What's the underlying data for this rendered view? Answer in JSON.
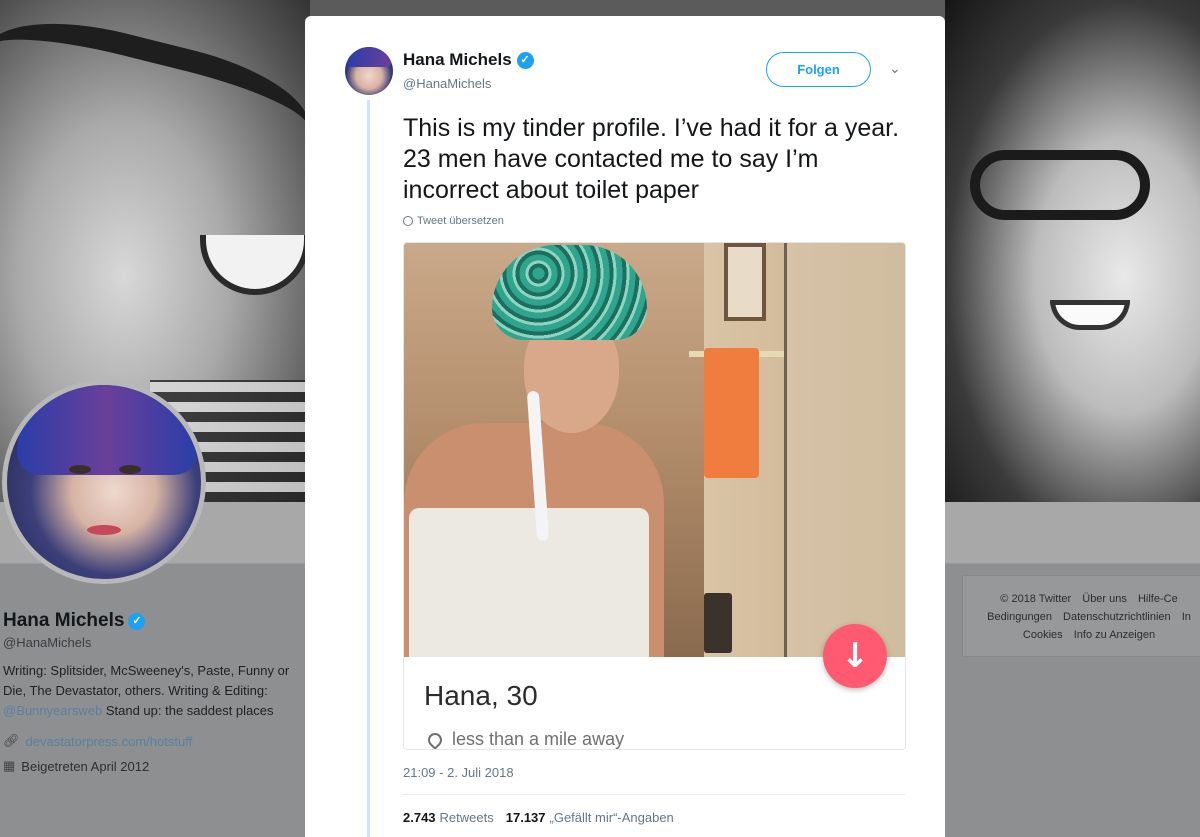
{
  "profile": {
    "name": "Hana Michels",
    "handle": "@HanaMichels",
    "bio_text": "Writing: Splitsider, McSweeney's, Paste, Funny or Die, The Devastator, others. Writing & Editing:",
    "bio_link": "@Bunnyearsweb",
    "bio_tail": "Stand up: the saddest places",
    "website": "devastatorpress.com/hotstuff",
    "joined": "Beigetreten April 2012"
  },
  "footer": {
    "links": [
      "© 2018 Twitter",
      "Über uns",
      "Hilfe-Ce",
      "Bedingungen",
      "Datenschutzrichtlinien",
      "In",
      "Cookies",
      "Info zu Anzeigen"
    ]
  },
  "tweet": {
    "author_name": "Hana Michels",
    "author_handle": "@HanaMichels",
    "follow_label": "Folgen",
    "text": "This is my tinder profile. I’ve had it for a year. 23 men have contacted me to say I’m incorrect about toilet paper",
    "translate_label": "Tweet übersetzen",
    "timestamp": "21:09 - 2. Juli 2018",
    "retweets_count": "2.743",
    "retweets_label": "Retweets",
    "likes_count": "17.137",
    "likes_label": "„Gefällt mir“-Angaben"
  },
  "card": {
    "name_age": "Hana, 30",
    "distance": "less than a mile away",
    "button_icon": "arrow-down-icon",
    "button_color": "#ff5a71"
  },
  "colors": {
    "twitter_blue": "#1da1f2",
    "muted_text": "#657786"
  }
}
